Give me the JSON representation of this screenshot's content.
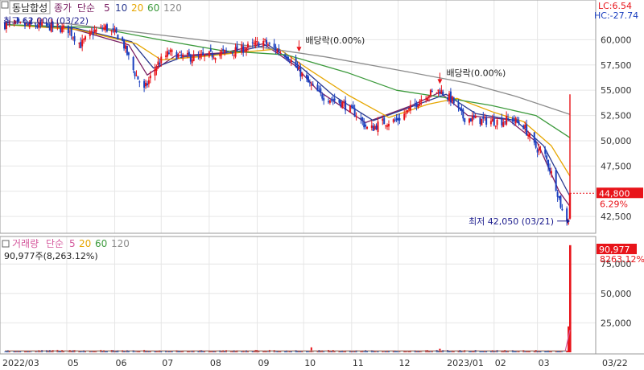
{
  "header": {
    "title": "동남합성",
    "price_legend": {
      "label": "종가",
      "method": "단순",
      "periods": [
        "5",
        "10",
        "20",
        "60",
        "120"
      ]
    },
    "lc_label": "LC:6.54",
    "hc_label": "HC:-27.74"
  },
  "colors": {
    "up": "#e8141a",
    "down": "#1a3fbf",
    "ma5": "#7a1f63",
    "ma10": "#2b3a8f",
    "ma20": "#e6a600",
    "ma60": "#3c9a3c",
    "ma120": "#8c8c8c",
    "vol_ma5": "#d4589c",
    "vol_ma20": "#e6a600",
    "vol_ma60": "#3c9a3c",
    "vol_ma120": "#8c8c8c",
    "grid": "#e6e6e6",
    "axis_text": "#333333",
    "price_tag_bg": "#e8141a",
    "annotation": "#1a1a8c"
  },
  "chart_data": [
    {
      "type": "candlestick",
      "title": "동남합성",
      "ylim": [
        41000,
        62500
      ],
      "y_ticks": [
        "42,500",
        "45,000",
        "47,500",
        "50,000",
        "52,500",
        "55,000",
        "57,500",
        "60,000"
      ],
      "y_tick_values": [
        42500,
        45000,
        47500,
        50000,
        52500,
        55000,
        57500,
        60000
      ],
      "x_ticks": [
        "2022/03",
        "05",
        "06",
        "07",
        "08",
        "09",
        "10",
        "11",
        "12",
        "2023/01",
        "02",
        "03",
        "03/22"
      ],
      "close_path": [
        [
          "2022-03-22",
          61500
        ],
        [
          "2022-04-05",
          61400
        ],
        [
          "2022-04-20",
          61300
        ],
        [
          "2022-05-02",
          61000
        ],
        [
          "2022-05-10",
          59500
        ],
        [
          "2022-05-18",
          60800
        ],
        [
          "2022-05-26",
          61200
        ],
        [
          "2022-06-05",
          60200
        ],
        [
          "2022-06-13",
          57000
        ],
        [
          "2022-06-20",
          55000
        ],
        [
          "2022-06-28",
          57500
        ],
        [
          "2022-07-06",
          58700
        ],
        [
          "2022-07-15",
          58300
        ],
        [
          "2022-07-25",
          58200
        ],
        [
          "2022-08-05",
          58600
        ],
        [
          "2022-08-15",
          58800
        ],
        [
          "2022-08-25",
          59200
        ],
        [
          "2022-09-05",
          59800
        ],
        [
          "2022-09-10",
          59300
        ],
        [
          "2022-09-20",
          58500
        ],
        [
          "2022-09-30",
          56500
        ],
        [
          "2022-10-05",
          55500
        ],
        [
          "2022-10-12",
          54500
        ],
        [
          "2022-10-25",
          53800
        ],
        [
          "2022-11-05",
          52500
        ],
        [
          "2022-11-12",
          51000
        ],
        [
          "2022-11-20",
          51800
        ],
        [
          "2022-11-30",
          52000
        ],
        [
          "2022-12-08",
          53000
        ],
        [
          "2022-12-18",
          54500
        ],
        [
          "2022-12-28",
          55000
        ],
        [
          "2023-01-05",
          54000
        ],
        [
          "2023-01-12",
          52300
        ],
        [
          "2023-01-25",
          52000
        ],
        [
          "2023-02-05",
          51900
        ],
        [
          "2023-02-12",
          52200
        ],
        [
          "2023-02-20",
          51500
        ],
        [
          "2023-02-27",
          49500
        ],
        [
          "2023-03-06",
          48500
        ],
        [
          "2023-03-13",
          45500
        ],
        [
          "2023-03-17",
          43000
        ],
        [
          "2023-03-21",
          42100
        ],
        [
          "2023-03-22",
          44800
        ]
      ],
      "last_day_spike": {
        "date": "2023-03-22",
        "open": 42300,
        "high": 54600,
        "low": 42200,
        "close": 44800
      },
      "moving_averages": [
        {
          "name": "5",
          "color_key": "ma5",
          "path": [
            [
              "2022-03-22",
              61500
            ],
            [
              "2022-05-02",
              61200
            ],
            [
              "2022-06-10",
              59500
            ],
            [
              "2022-06-22",
              56500
            ],
            [
              "2022-07-10",
              58400
            ],
            [
              "2022-08-10",
              58700
            ],
            [
              "2022-09-05",
              59600
            ],
            [
              "2022-09-25",
              57500
            ],
            [
              "2022-10-10",
              55000
            ],
            [
              "2022-11-10",
              51800
            ],
            [
              "2022-12-10",
              53500
            ],
            [
              "2022-12-28",
              54800
            ],
            [
              "2023-01-15",
              52500
            ],
            [
              "2023-02-10",
              52100
            ],
            [
              "2023-03-01",
              49800
            ],
            [
              "2023-03-15",
              45000
            ],
            [
              "2023-03-22",
              43500
            ]
          ]
        },
        {
          "name": "10",
          "color_key": "ma10",
          "path": [
            [
              "2022-03-22",
              61500
            ],
            [
              "2022-05-05",
              61200
            ],
            [
              "2022-06-12",
              59800
            ],
            [
              "2022-06-26",
              57200
            ],
            [
              "2022-07-15",
              58300
            ],
            [
              "2022-08-15",
              58700
            ],
            [
              "2022-09-08",
              59500
            ],
            [
              "2022-09-30",
              57200
            ],
            [
              "2022-10-20",
              54500
            ],
            [
              "2022-11-15",
              52000
            ],
            [
              "2022-12-12",
              53500
            ],
            [
              "2023-01-01",
              54600
            ],
            [
              "2023-01-20",
              52700
            ],
            [
              "2023-02-15",
              52000
            ],
            [
              "2023-03-05",
              49500
            ],
            [
              "2023-03-22",
              44500
            ]
          ]
        },
        {
          "name": "20",
          "color_key": "ma20",
          "path": [
            [
              "2022-03-22",
              61500
            ],
            [
              "2022-05-08",
              61000
            ],
            [
              "2022-06-15",
              59600
            ],
            [
              "2022-07-01",
              58000
            ],
            [
              "2022-07-25",
              58300
            ],
            [
              "2022-08-25",
              58800
            ],
            [
              "2022-09-15",
              59100
            ],
            [
              "2022-10-05",
              57000
            ],
            [
              "2022-10-30",
              54500
            ],
            [
              "2022-11-25",
              52300
            ],
            [
              "2022-12-20",
              53600
            ],
            [
              "2023-01-08",
              54200
            ],
            [
              "2023-02-01",
              52800
            ],
            [
              "2023-02-20",
              51900
            ],
            [
              "2023-03-10",
              49500
            ],
            [
              "2023-03-22",
              46500
            ]
          ]
        },
        {
          "name": "60",
          "color_key": "ma60",
          "path": [
            [
              "2022-03-22",
              61500
            ],
            [
              "2022-05-20",
              61200
            ],
            [
              "2022-06-30",
              60000
            ],
            [
              "2022-08-10",
              58900
            ],
            [
              "2022-09-20",
              58500
            ],
            [
              "2022-10-30",
              56700
            ],
            [
              "2022-11-30",
              55000
            ],
            [
              "2022-12-30",
              54300
            ],
            [
              "2023-01-30",
              53500
            ],
            [
              "2023-02-28",
              52500
            ],
            [
              "2023-03-22",
              50300
            ]
          ]
        },
        {
          "name": "120",
          "color_key": "ma120",
          "path": [
            [
              "2022-03-22",
              61800
            ],
            [
              "2022-05-01",
              61600
            ],
            [
              "2022-06-01",
              61000
            ],
            [
              "2022-07-15",
              60200
            ],
            [
              "2022-09-01",
              59300
            ],
            [
              "2022-10-15",
              58300
            ],
            [
              "2022-12-01",
              57000
            ],
            [
              "2023-01-15",
              55700
            ],
            [
              "2023-02-15",
              54400
            ],
            [
              "2023-03-22",
              52600
            ]
          ]
        }
      ],
      "annotations": [
        {
          "text": "최고 62,000 (03/22)",
          "date": "2022-03-22",
          "value": 62000,
          "kind": "high"
        },
        {
          "text": "배당락(0.00%)",
          "date": "2022-09-28",
          "value": 58500,
          "kind": "event"
        },
        {
          "text": "배당락(0.00%)",
          "date": "2022-12-28",
          "value": 55300,
          "kind": "event"
        },
        {
          "text": "최저 42,050 (03/21)",
          "date": "2023-03-21",
          "value": 42050,
          "kind": "low"
        }
      ],
      "current_price": {
        "label": "44,800",
        "change_label": "6.29%",
        "value": 44800
      },
      "grid": true
    },
    {
      "type": "bar",
      "title": "거래량",
      "legend": {
        "label": "거래량",
        "method": "단순",
        "periods": [
          "5",
          "20",
          "60",
          "120"
        ]
      },
      "info_text": "90,977주(8,263.12%)",
      "ylim": [
        0,
        97000
      ],
      "y_ticks": [
        "25,000",
        "50,000",
        "75,000"
      ],
      "y_tick_values": [
        25000,
        50000,
        75000
      ],
      "current_value": {
        "label": "90,977",
        "pct_label": "8263.12%"
      },
      "baseline_volume": 1100,
      "spikes": [
        {
          "date": "2022-10-06",
          "value": 4200
        },
        {
          "date": "2022-12-28",
          "value": 3000
        },
        {
          "date": "2023-03-21",
          "value": 22000
        },
        {
          "date": "2023-03-22",
          "value": 90977
        }
      ],
      "grid": true
    }
  ]
}
